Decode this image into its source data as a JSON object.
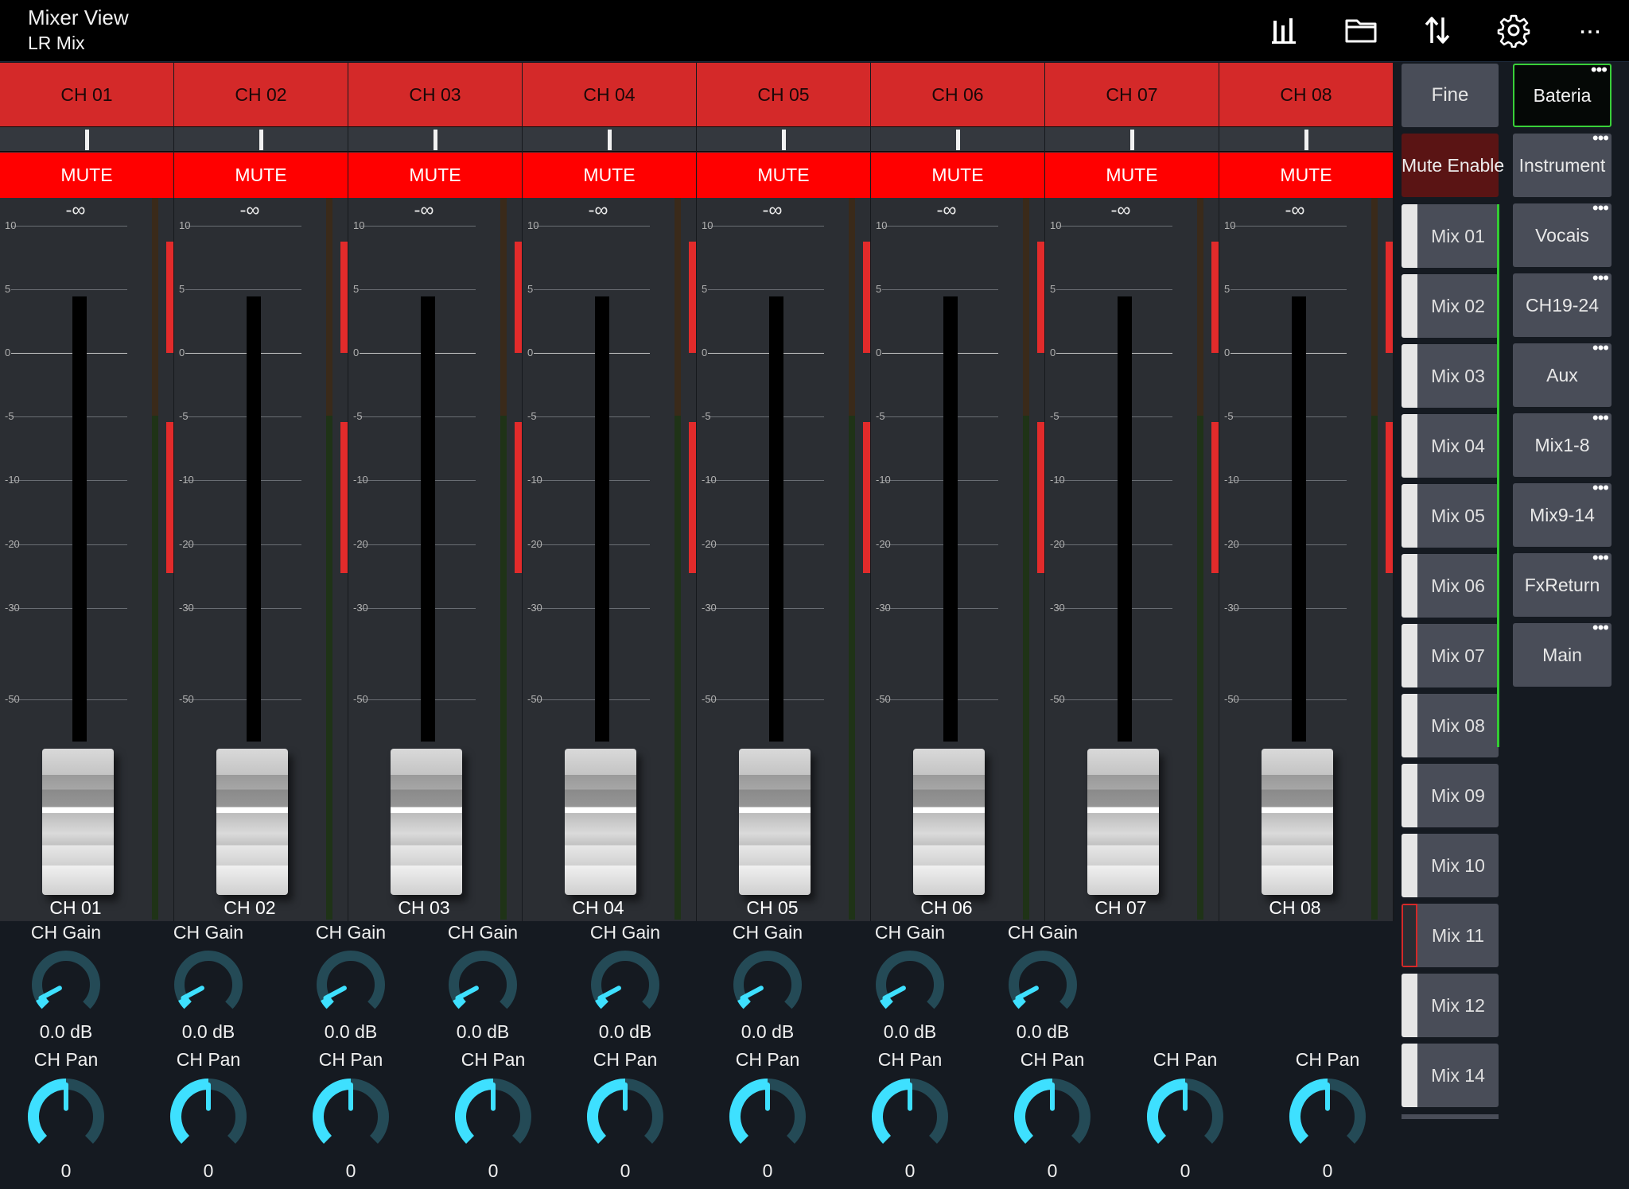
{
  "header": {
    "title": "Mixer View",
    "subtitle": "LR Mix",
    "icons": [
      "meters-icon",
      "folder-icon",
      "transfer-icon",
      "settings-gear-icon",
      "more-options-icon"
    ],
    "more_label": "..."
  },
  "colors": {
    "strip_header": "#d42929",
    "mute_active": "#ff0000",
    "knob_arc": "#3ee0ff",
    "selected_outline": "#39d039"
  },
  "strips": [
    {
      "name": "CH 01",
      "mute": "MUTE",
      "level": "-∞",
      "label": "CH 01"
    },
    {
      "name": "CH 02",
      "mute": "MUTE",
      "level": "-∞",
      "label": "CH 02"
    },
    {
      "name": "CH 03",
      "mute": "MUTE",
      "level": "-∞",
      "label": "CH 03"
    },
    {
      "name": "CH 04",
      "mute": "MUTE",
      "level": "-∞",
      "label": "CH 04"
    },
    {
      "name": "CH 05",
      "mute": "MUTE",
      "level": "-∞",
      "label": "CH 05"
    },
    {
      "name": "CH 06",
      "mute": "MUTE",
      "level": "-∞",
      "label": "CH 06"
    },
    {
      "name": "CH 07",
      "mute": "MUTE",
      "level": "-∞",
      "label": "CH 07"
    },
    {
      "name": "CH 08",
      "mute": "MUTE",
      "level": "-∞",
      "label": "CH 08"
    }
  ],
  "fader_scale": [
    "10",
    "5",
    "0",
    "-5",
    "-10",
    "-20",
    "-30",
    "-50"
  ],
  "gain_knobs": [
    {
      "label": "CH Gain",
      "value": "0.0 dB"
    },
    {
      "label": "CH Gain",
      "value": "0.0 dB"
    },
    {
      "label": "CH Gain",
      "value": "0.0 dB"
    },
    {
      "label": "CH Gain",
      "value": "0.0 dB"
    },
    {
      "label": "CH Gain",
      "value": "0.0 dB"
    },
    {
      "label": "CH Gain",
      "value": "0.0 dB"
    },
    {
      "label": "CH Gain",
      "value": "0.0 dB"
    },
    {
      "label": "CH Gain",
      "value": "0.0 dB"
    }
  ],
  "pan_knobs": [
    {
      "label": "CH Pan",
      "value": "0"
    },
    {
      "label": "CH Pan",
      "value": "0"
    },
    {
      "label": "CH Pan",
      "value": "0"
    },
    {
      "label": "CH Pan",
      "value": "0"
    },
    {
      "label": "CH Pan",
      "value": "0"
    },
    {
      "label": "CH Pan",
      "value": "0"
    },
    {
      "label": "CH Pan",
      "value": "0"
    },
    {
      "label": "CH Pan",
      "value": "0"
    },
    {
      "label": "CH Pan",
      "value": "0"
    },
    {
      "label": "CH Pan",
      "value": "0"
    }
  ],
  "controls": {
    "fine": "Fine",
    "mute_enable": "Mute Enable"
  },
  "mixes": [
    "Mix 01",
    "Mix 02",
    "Mix 03",
    "Mix 04",
    "Mix 05",
    "Mix 06",
    "Mix 07",
    "Mix 08",
    "Mix 09",
    "Mix 10",
    "Mix 11",
    "Mix 12",
    "Mix 14"
  ],
  "layers": {
    "selected": "Bateria",
    "items": [
      "Bateria",
      "Instrument",
      "Vocais",
      "CH19-24",
      "Aux",
      "Mix1-8",
      "Mix9-14",
      "FxReturn",
      "Main"
    ]
  }
}
